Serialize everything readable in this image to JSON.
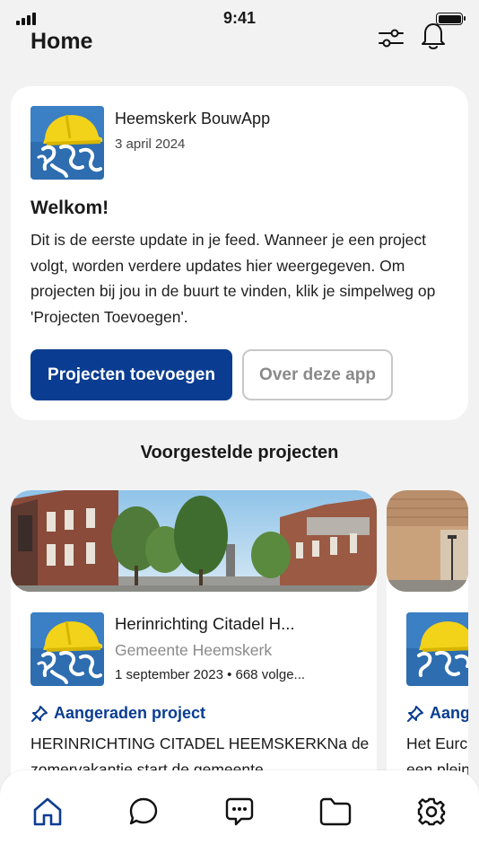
{
  "status_bar": {
    "time": "9:41"
  },
  "header": {
    "title": "Home",
    "filter_icon": "sliders-icon",
    "notification_icon": "bell-icon"
  },
  "colors": {
    "brand_blue": "#0a3d91",
    "background": "#f2f2f2",
    "muted_text": "#8a8a8a"
  },
  "welcome_card": {
    "sender": "Heemskerk BouwApp",
    "date": "3 april 2024",
    "heading": "Welkom!",
    "body": "Dit is de eerste update in je feed. Wanneer je een project volgt, worden verdere updates hier weergegeven. Om projecten bij jou in de buurt te vinden, klik je simpelweg op 'Projecten Toevoegen'.",
    "primary_button": "Projecten toevoegen",
    "secondary_button": "Over deze app"
  },
  "suggested": {
    "title": "Voorgestelde projecten",
    "projects": [
      {
        "title": "Herinrichting Citadel H...",
        "organisation": "Gemeente Heemskerk",
        "meta": "1 september 2023 • 668 volge...",
        "tag": "Aangeraden project",
        "description": "HERINRICHTING CITADEL HEEMSKERKNa de",
        "description_line2": "zomervakantie start de gemeente"
      },
      {
        "tag": "Aang",
        "description": "Het Eurc",
        "description_line2": "een plein"
      }
    ]
  },
  "bottom_nav": {
    "items": [
      {
        "icon": "home-icon",
        "active": true
      },
      {
        "icon": "chat-bubble-icon",
        "active": false
      },
      {
        "icon": "message-dots-icon",
        "active": false
      },
      {
        "icon": "folder-icon",
        "active": false
      },
      {
        "icon": "settings-gear-icon",
        "active": false
      }
    ]
  }
}
